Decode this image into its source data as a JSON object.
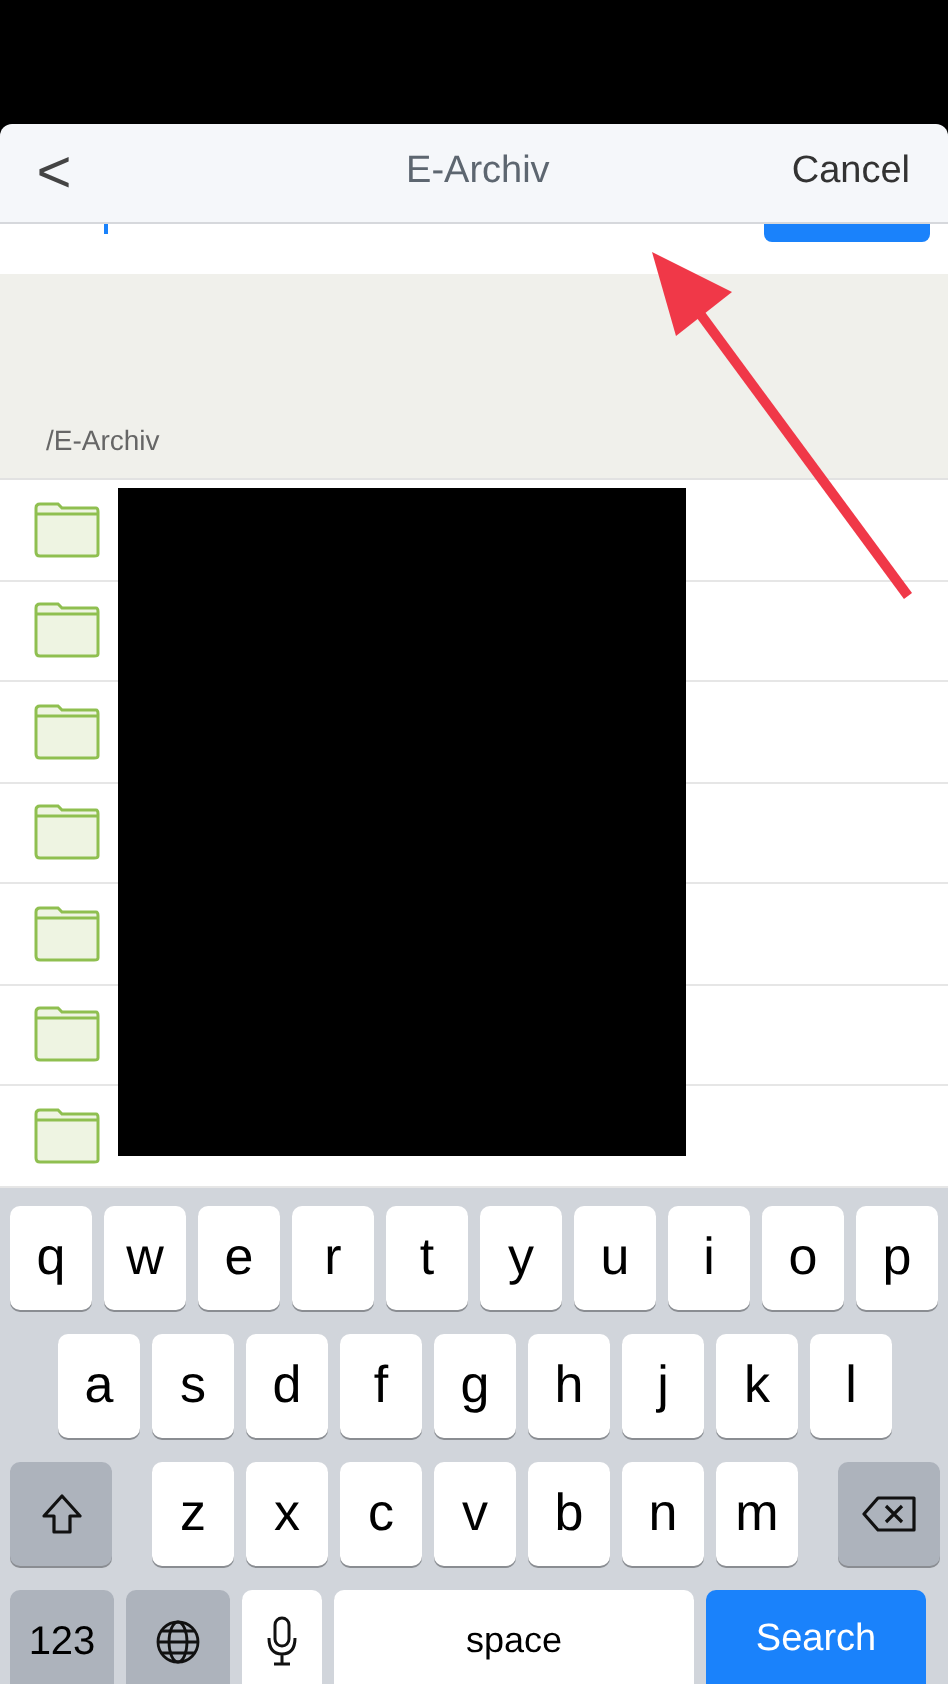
{
  "nav_bar": {
    "back": "<",
    "title": "E-Archiv",
    "cancel": "Cancel"
  },
  "path_label": "/E-Archiv",
  "folder_rows": [
    {
      "kind": "folder"
    },
    {
      "kind": "folder"
    },
    {
      "kind": "folder"
    },
    {
      "kind": "folder"
    },
    {
      "kind": "folder"
    },
    {
      "kind": "folder"
    },
    {
      "kind": "folder"
    }
  ],
  "keyboard": {
    "top_letters": [
      {
        "kind": "letter",
        "label": "q"
      },
      {
        "kind": "letter",
        "label": "w"
      },
      {
        "kind": "letter",
        "label": "e"
      },
      {
        "kind": "letter",
        "label": "r"
      },
      {
        "kind": "letter",
        "label": "t"
      },
      {
        "kind": "letter",
        "label": "y"
      },
      {
        "kind": "letter",
        "label": "u"
      },
      {
        "kind": "letter",
        "label": "i"
      },
      {
        "kind": "letter",
        "label": "o"
      },
      {
        "kind": "letter",
        "label": "p"
      }
    ],
    "middle_letters": [
      {
        "kind": "letter",
        "label": "a"
      },
      {
        "kind": "letter",
        "label": "s"
      },
      {
        "kind": "letter",
        "label": "d"
      },
      {
        "kind": "letter",
        "label": "f"
      },
      {
        "kind": "letter",
        "label": "g"
      },
      {
        "kind": "letter",
        "label": "h"
      },
      {
        "kind": "letter",
        "label": "j"
      },
      {
        "kind": "letter",
        "label": "k"
      },
      {
        "kind": "letter",
        "label": "l"
      }
    ],
    "bottom_letters": [
      {
        "kind": "shift"
      },
      {
        "kind": "letter",
        "label": "z"
      },
      {
        "kind": "letter",
        "label": "x"
      },
      {
        "kind": "letter",
        "label": "c"
      },
      {
        "kind": "letter",
        "label": "v"
      },
      {
        "kind": "letter",
        "label": "b"
      },
      {
        "kind": "letter",
        "label": "n"
      },
      {
        "kind": "letter",
        "label": "m"
      },
      {
        "kind": "backspace"
      }
    ],
    "function_keys": [
      {
        "kind": "numbers",
        "label": "123"
      },
      {
        "kind": "globe"
      },
      {
        "kind": "mic"
      },
      {
        "kind": "space",
        "label": "space"
      },
      {
        "kind": "search",
        "label": "Search"
      }
    ]
  }
}
